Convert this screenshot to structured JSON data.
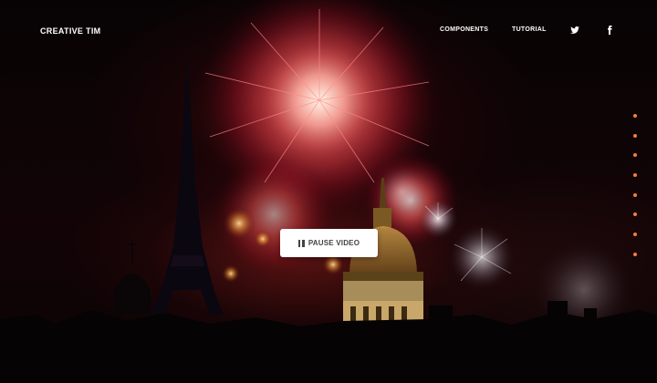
{
  "navbar": {
    "brand": "CREATIVE TIM",
    "links": [
      {
        "label": "COMPONENTS"
      },
      {
        "label": "TUTORIAL"
      }
    ],
    "social_icons": [
      "twitter-icon",
      "facebook-icon"
    ]
  },
  "hero": {
    "pause_button_label": "PAUSE VIDEO",
    "pause_icon": "pause-icon"
  },
  "section_dots": {
    "count": 8,
    "color": "#ff7a3a"
  },
  "colors": {
    "brand_text": "#ffffff",
    "button_bg": "#ffffff",
    "button_text": "#444444",
    "accent": "#ff7a3a"
  }
}
